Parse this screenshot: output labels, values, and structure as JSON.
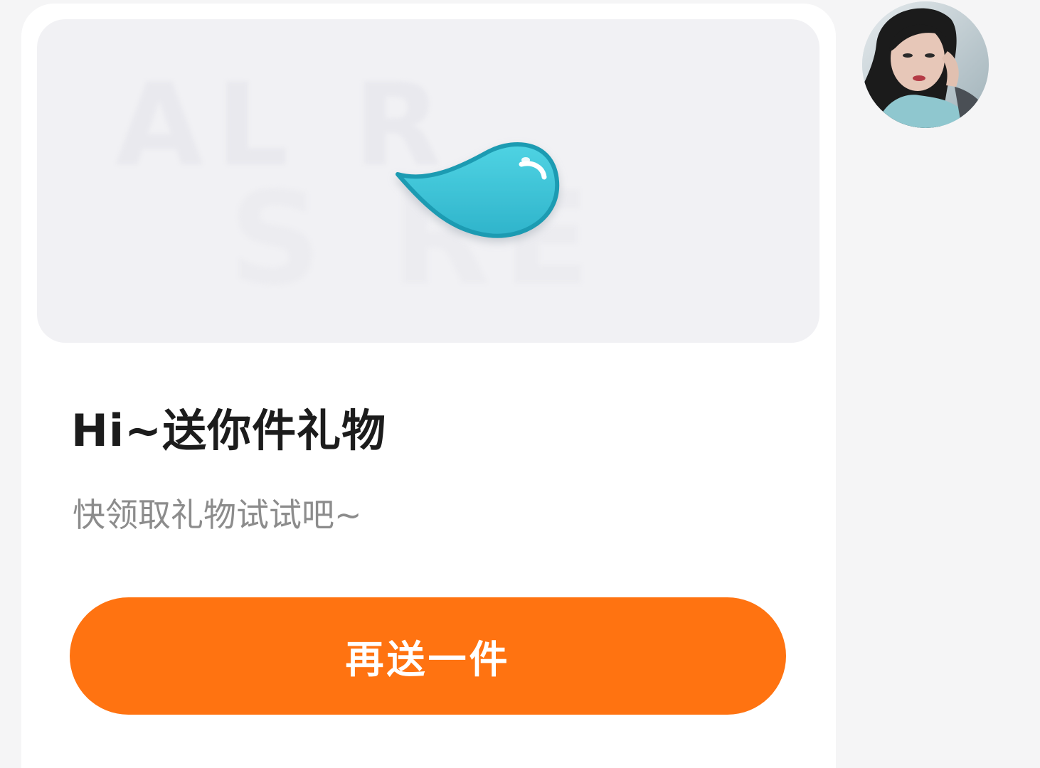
{
  "gift_card": {
    "image_watermark_top": "AL  R",
    "image_watermark_bottom": "S  RE",
    "title": "Hi~送你件礼物",
    "subtitle": "快领取礼物试试吧~",
    "send_again_button": "再送一件",
    "gift_icon": "water-drop-icon"
  },
  "avatar": {
    "icon": "user-avatar"
  },
  "colors": {
    "accent": "#ff7311",
    "drop": "#3fc3d6",
    "drop_outline": "#1f9bb2",
    "card": "#ffffff",
    "background": "#f5f5f6"
  }
}
